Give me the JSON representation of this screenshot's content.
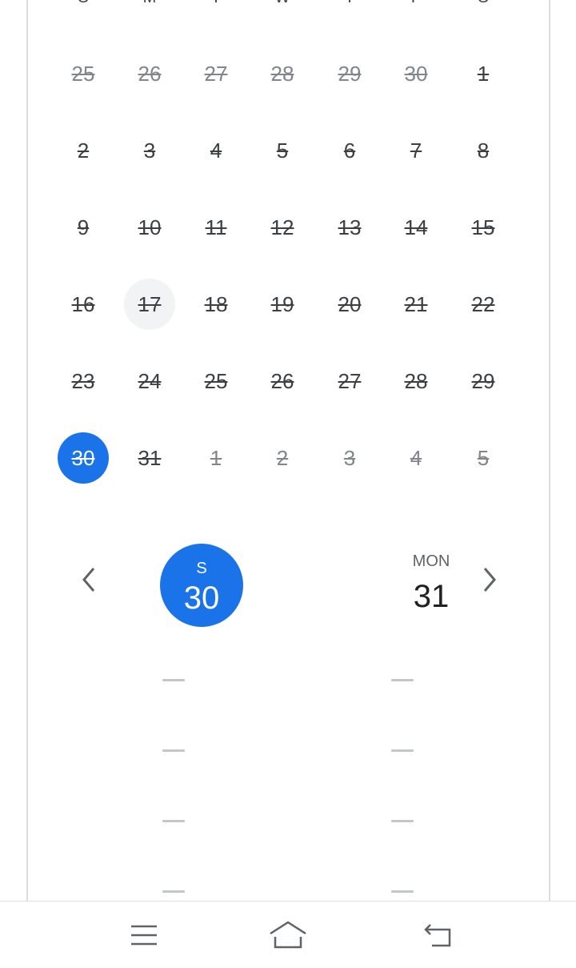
{
  "calendar": {
    "weekdays": [
      "S",
      "M",
      "T",
      "W",
      "T",
      "F",
      "S"
    ],
    "weeks": [
      [
        "25",
        "26",
        "27",
        "28",
        "29",
        "30",
        "1"
      ],
      [
        "2",
        "3",
        "4",
        "5",
        "6",
        "7",
        "8"
      ],
      [
        "9",
        "10",
        "11",
        "12",
        "13",
        "14",
        "15"
      ],
      [
        "16",
        "17",
        "18",
        "19",
        "20",
        "21",
        "22"
      ],
      [
        "23",
        "24",
        "25",
        "26",
        "27",
        "28",
        "29"
      ],
      [
        "30",
        "31",
        "1",
        "2",
        "3",
        "4",
        "5"
      ]
    ],
    "today": "17",
    "selected": "30"
  },
  "week_strip": {
    "prev_icon": "chevron-left-icon",
    "next_icon": "chevron-right-icon",
    "days": [
      {
        "dow": "S",
        "num": "30"
      },
      {
        "dow": "MON",
        "num": "31"
      }
    ]
  },
  "navbar": {
    "menu_icon": "menu-icon",
    "home_icon": "home-icon",
    "back_icon": "back-icon"
  },
  "colors": {
    "accent": "#1a73e8",
    "today_bg": "#f1f3f4",
    "text": "#3c4043",
    "muted": "#80868b"
  }
}
